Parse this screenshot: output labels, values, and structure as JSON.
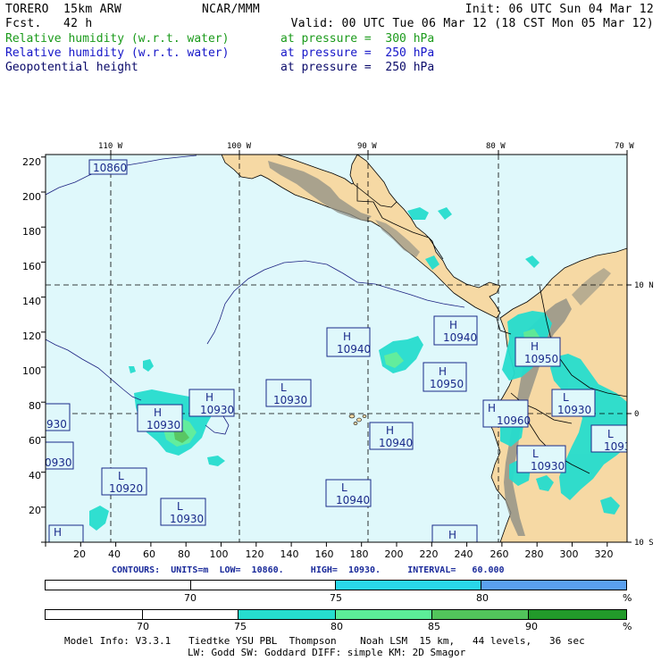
{
  "header": {
    "model_line": "TORERO  15km ARW",
    "fcst_line": "Fcst.   42 h",
    "center": "NCAR/MMM",
    "init": "Init: 06 UTC Sun 04 Mar 12",
    "valid": "Valid: 00 UTC Tue 06 Mar 12 (18 CST Mon 05 Mar 12)"
  },
  "fields": [
    {
      "name": "Relative humidity (w.r.t. water)",
      "level": "at pressure =  300 hPa",
      "color": "#1a9a1a"
    },
    {
      "name": "Relative humidity (w.r.t. water)",
      "level": "at pressure =  250 hPa",
      "color": "#1515c8"
    },
    {
      "name": "Geopotential height",
      "level": "at pressure =  250 hPa",
      "color": "#0a0a6a"
    }
  ],
  "map": {
    "lon_labels": [
      "110 W",
      "100 W",
      "90 W",
      "80 W",
      "70 W"
    ],
    "lat_labels_right": [
      "10 N",
      "0",
      "10 S"
    ],
    "y_ticks": [
      "220",
      "200",
      "180",
      "160",
      "140",
      "120",
      "100",
      "80",
      "60",
      "40",
      "20"
    ],
    "x_ticks": [
      "20",
      "40",
      "60",
      "80",
      "100",
      "120",
      "140",
      "160",
      "180",
      "200",
      "220",
      "240",
      "260",
      "280",
      "300",
      "320"
    ],
    "ocean_color": "#dff8fb",
    "land_color": "#f6d9a4",
    "mountain_color": "#8f8f86",
    "highs_lows": [
      {
        "kind": "",
        "value": "10860"
      },
      {
        "kind": "H",
        "value": "10940"
      },
      {
        "kind": "H",
        "value": "10940"
      },
      {
        "kind": "H",
        "value": "10950"
      },
      {
        "kind": "H",
        "value": "10950"
      },
      {
        "kind": "L",
        "value": "10930"
      },
      {
        "kind": "H",
        "value": "10930"
      },
      {
        "kind": "H",
        "value": "10930"
      },
      {
        "kind": "H",
        "value": "10960"
      },
      {
        "kind": "L",
        "value": "10930"
      },
      {
        "kind": "H",
        "value": "10940"
      },
      {
        "kind": "L",
        "value": "10920"
      },
      {
        "kind": "L",
        "value": "10930"
      },
      {
        "kind": "L",
        "value": "10940"
      },
      {
        "kind": "L",
        "value": "10930"
      },
      {
        "kind": "",
        "value": "930"
      },
      {
        "kind": "",
        "value": "0930"
      },
      {
        "kind": "H",
        "value": "10930"
      },
      {
        "kind": "L",
        "value": "1093"
      },
      {
        "kind": "H",
        "value": "10930"
      },
      {
        "kind": "H",
        "value": ""
      }
    ]
  },
  "contours_info": {
    "label": "CONTOURS:",
    "units": "UNITS=m",
    "low": "LOW=  10860.",
    "high": "HIGH=  10930.",
    "interval": "INTERVAL=   60.000"
  },
  "bar_250": {
    "labels": [
      "70",
      "75",
      "80"
    ],
    "unit": "%",
    "colors": [
      "#ffffff",
      "#ffffff",
      "#29d7ea",
      "#5aa0ef"
    ]
  },
  "bar_300": {
    "labels": [
      "70",
      "75",
      "80",
      "85",
      "90"
    ],
    "unit": "%",
    "colors": [
      "#ffffff",
      "#ffffff",
      "#26ddce",
      "#5ced98",
      "#52c45b",
      "#229a2a"
    ]
  },
  "footer": {
    "line1": "Model Info: V3.3.1   Tiedtke YSU PBL  Thompson    Noah LSM  15 km,   44 levels,   36 sec",
    "line2": "LW: Godd SW: Goddard DIFF: simple KM: 2D Smagor"
  }
}
